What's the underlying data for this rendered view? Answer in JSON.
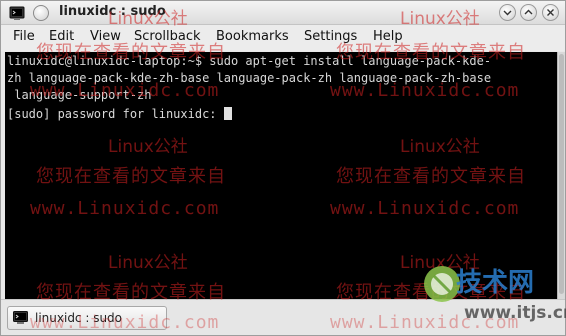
{
  "window": {
    "title": "linuxidc : sudo"
  },
  "menubar": {
    "items": [
      "File",
      "Edit",
      "View",
      "Scrollback",
      "Bookmarks",
      "Settings",
      "Help"
    ]
  },
  "terminal": {
    "lines": [
      "linuxidc@linuxidc-laptop:~$ sudo apt-get install language-pack-kde-",
      "zh language-pack-kde-zh-base language-pack-zh language-pack-zh-base",
      " language-support-zh",
      "[sudo] password for linuxidc: "
    ]
  },
  "tabs": [
    {
      "label": "linuxidc : sudo"
    }
  ],
  "watermark": {
    "site": "www.Linuxidc.com",
    "brand": "Linux公社",
    "caption": "您现在查看的文章来自"
  },
  "logo": {
    "text": "技术网",
    "url": "www.itjs.cn"
  },
  "colors": {
    "terminal_bg": "#000000",
    "terminal_fg": "#d8d8d8",
    "watermark": "#cf2222"
  }
}
